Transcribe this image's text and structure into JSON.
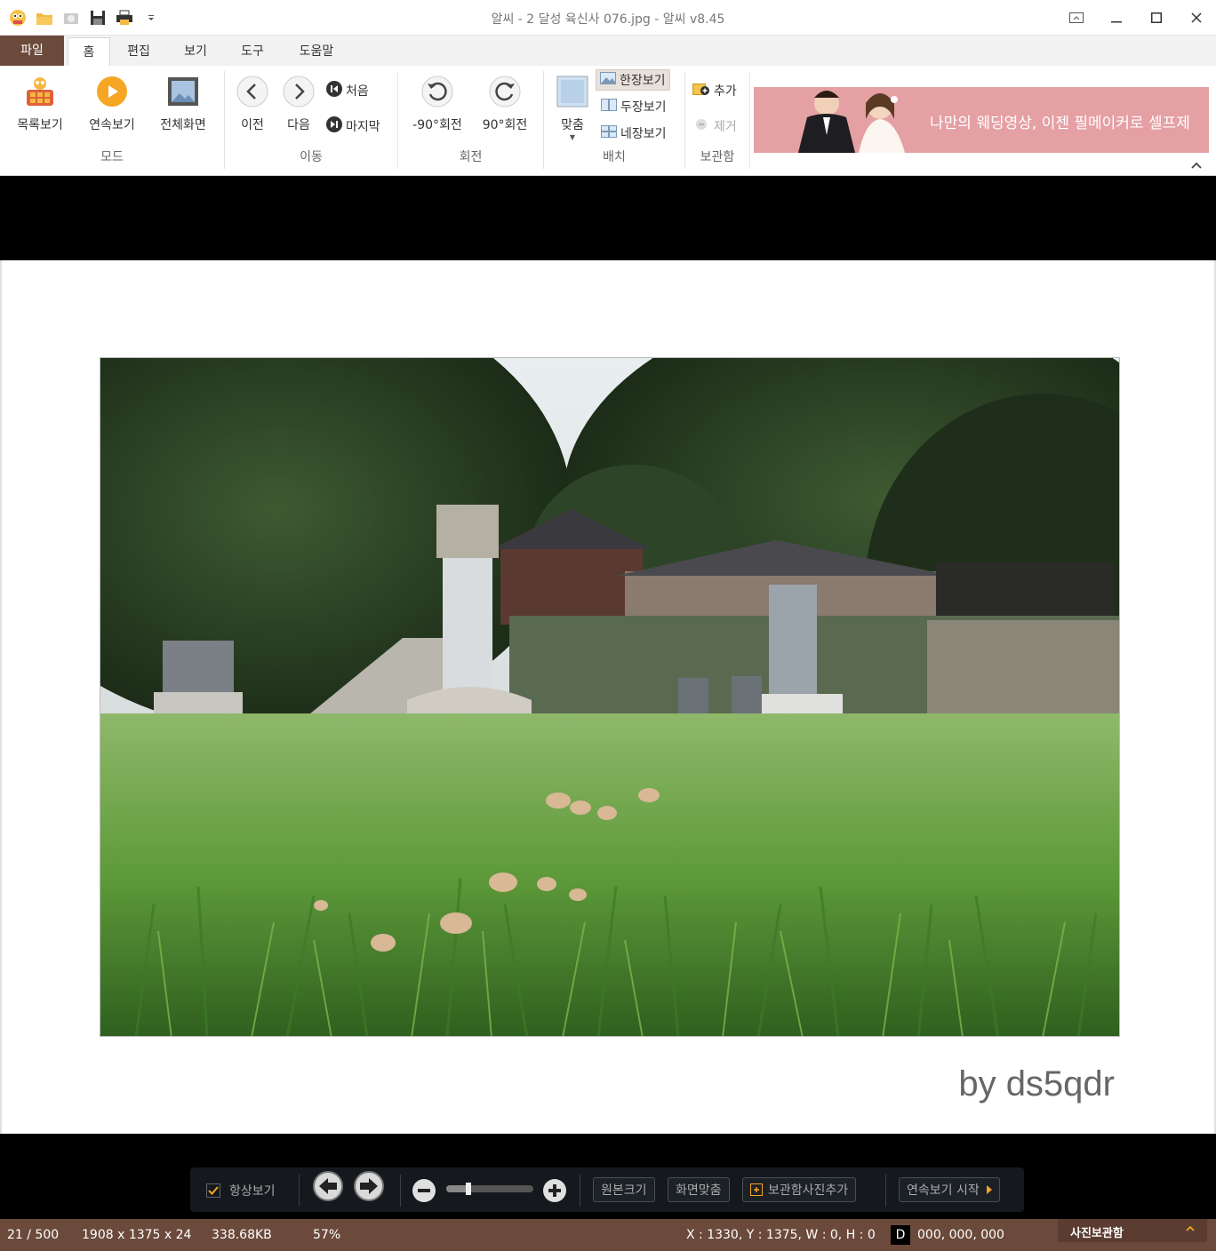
{
  "window": {
    "title": "알씨 - 2 달성 육신사 076.jpg - 알씨 v8.45"
  },
  "tabs": {
    "file": "파일",
    "home": "홈",
    "edit": "편집",
    "view": "보기",
    "tools": "도구",
    "help": "도움말"
  },
  "ribbon": {
    "mode": {
      "label": "모드",
      "list_view": "목록보기",
      "slideshow": "연속보기",
      "fullscreen": "전체화면"
    },
    "move": {
      "label": "이동",
      "prev": "이전",
      "next": "다음",
      "first": "처음",
      "last": "마지막"
    },
    "rotate": {
      "label": "회전",
      "ccw": "-90°회전",
      "cw": "90°회전"
    },
    "layout": {
      "label": "배치",
      "fit": "맞춤",
      "single": "한장보기",
      "double": "두장보기",
      "quad": "네장보기"
    },
    "storage": {
      "label": "보관함",
      "add": "추가",
      "remove": "제거"
    },
    "ad": {
      "text": "나만의 웨딩영상, 이젠 필메이커로 셀프제"
    }
  },
  "viewer": {
    "watermark": "by ds5qdr"
  },
  "floatbar": {
    "always_show": "항상보기",
    "always_show_checked": true,
    "zoom_level": 0.25,
    "original_size": "원본크기",
    "fit_screen": "화면맞춤",
    "add_to_storage": "보관함사진추가",
    "start_slideshow": "연속보기 시작"
  },
  "status": {
    "index": "21 / 500",
    "dimensions": "1908 x 1375 x 24",
    "filesize": "338.68KB",
    "zoom": "57%",
    "coords": "X : 1330, Y : 1375, W : 0, H : 0",
    "d_label": "D",
    "color": "000, 000, 000",
    "photo_storage": "사진보관함"
  },
  "colors": {
    "accent": "#6b4a3c",
    "ad_bg": "#e5a0a4",
    "play_orange": "#f5a623"
  }
}
